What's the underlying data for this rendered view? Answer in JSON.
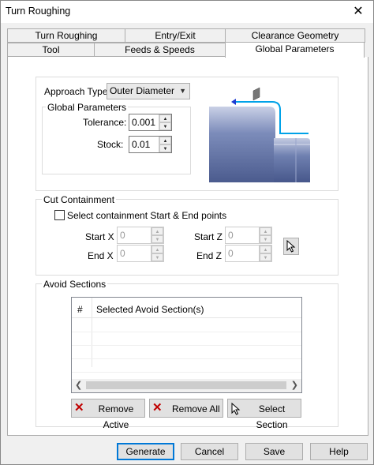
{
  "window": {
    "title": "Turn Roughing",
    "close_symbol": "✕"
  },
  "tabs_row1": [
    "Turn Roughing",
    "Entry/Exit",
    "Clearance Geometry"
  ],
  "tabs_row2": [
    "Tool",
    "Feeds & Speeds",
    "Global Parameters"
  ],
  "approach": {
    "label": "Approach Type",
    "value": "Outer Diameter"
  },
  "global_params": {
    "group_label": "Global Parameters",
    "tolerance_label": "Tolerance:",
    "tolerance_value": "0.001",
    "stock_label": "Stock:",
    "stock_value": "0.01"
  },
  "cut_containment": {
    "group_label": "Cut Containment",
    "checkbox_label": "Select containment Start & End points",
    "start_x_label": "Start X",
    "start_x_value": "0",
    "end_x_label": "End X",
    "end_x_value": "0",
    "start_z_label": "Start Z",
    "start_z_value": "0",
    "end_z_label": "End Z",
    "end_z_value": "0"
  },
  "avoid_sections": {
    "group_label": "Avoid Sections",
    "col_num": "#",
    "col_name": "Selected Avoid Section(s)",
    "remove_active": "Remove Active",
    "remove_all": "Remove All",
    "select_section": "Select Section"
  },
  "footer": {
    "generate": "Generate",
    "cancel": "Cancel",
    "save": "Save",
    "help": "Help"
  },
  "colors": {
    "toolpath": "#00a2e8",
    "part": "#5b6fa6",
    "focus": "#0078d7"
  }
}
